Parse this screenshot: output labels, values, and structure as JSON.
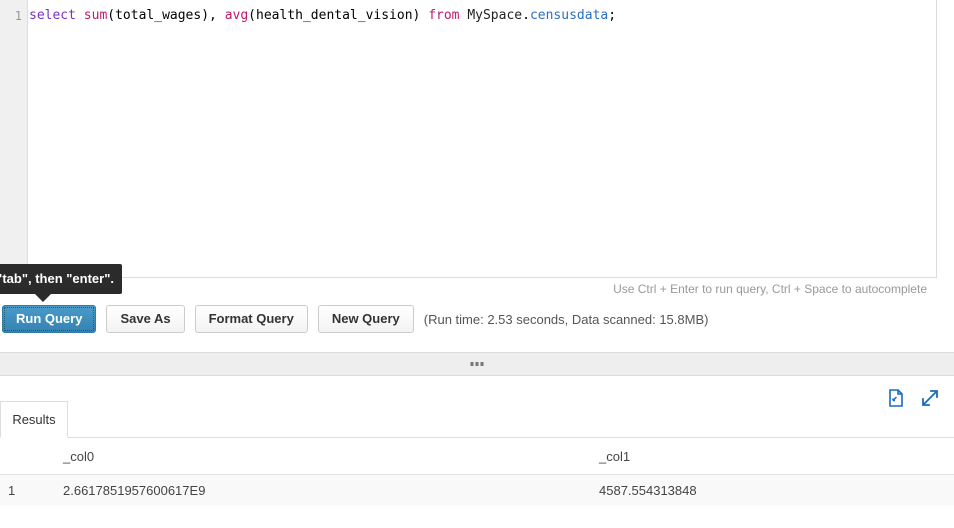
{
  "editor": {
    "line_number": "1",
    "tokens": [
      {
        "text": "select",
        "type": "keyword"
      },
      {
        "text": " ",
        "type": "plain"
      },
      {
        "text": "sum",
        "type": "func"
      },
      {
        "text": "(total_wages), ",
        "type": "plain"
      },
      {
        "text": "avg",
        "type": "func"
      },
      {
        "text": "(health_dental_vision) ",
        "type": "plain"
      },
      {
        "text": "from",
        "type": "from"
      },
      {
        "text": " ",
        "type": "plain"
      },
      {
        "text": "MySpace",
        "type": "schema"
      },
      {
        "text": ".",
        "type": "plain"
      },
      {
        "text": "censusdata",
        "type": "table"
      },
      {
        "text": ";",
        "type": "plain"
      }
    ],
    "query_text": "select sum(total_wages), avg(health_dental_vision) from MySpace.censusdata;",
    "hint": "Use Ctrl + Enter to run query, Ctrl + Space to autocomplete"
  },
  "tooltip": {
    "text": "s \"tab\", then \"enter\"."
  },
  "toolbar": {
    "run_query_label": "Run Query",
    "save_as_label": "Save As",
    "format_query_label": "Format Query",
    "new_query_label": "New Query",
    "run_info": "(Run time: 2.53 seconds, Data scanned: 15.8MB)",
    "primary_color": "#3c8dbc"
  },
  "results": {
    "tab_label": "Results",
    "download_icon": "file-download-icon",
    "expand_icon": "expand-arrows-icon",
    "icon_color": "#1a6bbd",
    "columns": [
      "",
      "_col0",
      "_col1"
    ],
    "rows": [
      {
        "index": "1",
        "col0": "2.6617851957600617E9",
        "col1": "4587.554313848"
      }
    ]
  }
}
